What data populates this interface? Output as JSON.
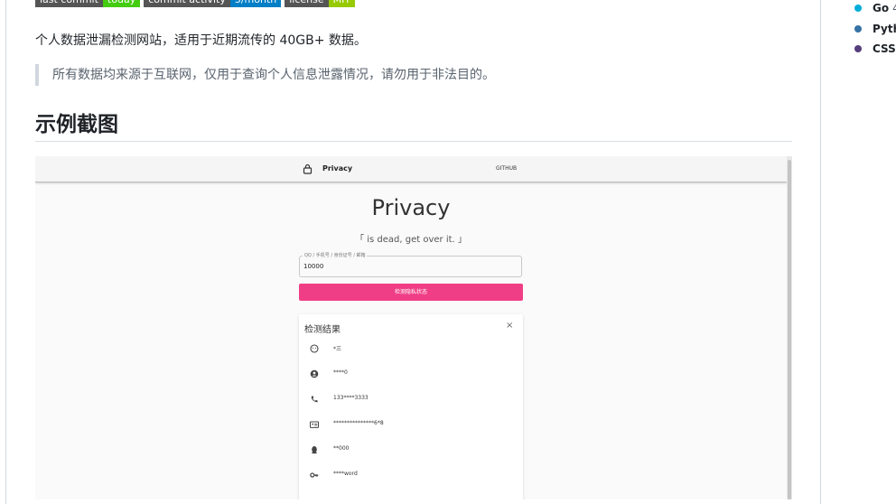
{
  "badges": [
    {
      "label": "last commit",
      "value": "today",
      "color": "#4c1"
    },
    {
      "label": "commit activity",
      "value": "5/month",
      "color": "#007ec6"
    },
    {
      "label": "license",
      "value": "MIT",
      "color": "#97ca00"
    }
  ],
  "readme": {
    "description": "个人数据泄漏检测网站，适用于近期流传的 40GB+ 数据。",
    "quote": "所有数据均来源于互联网，仅用于查询个人信息泄露情况，请勿用于非法目的。",
    "heading": "示例截图"
  },
  "screenshot": {
    "brand": "Privacy",
    "github": "GITHUB",
    "title": "Privacy",
    "subtitle": "「 is dead, get over it. 」",
    "field_label": "QQ / 手机号 / 身份证号 / 邮箱",
    "field_value": "10000",
    "button": "检测隐私状态",
    "card_title": "检测结果",
    "card_close": "×",
    "results": [
      {
        "icon": "face-icon",
        "value": "*三"
      },
      {
        "icon": "account-icon",
        "value": "****0"
      },
      {
        "icon": "phone-icon",
        "value": "133****3333"
      },
      {
        "icon": "id-card-icon",
        "value": "***************6*8"
      },
      {
        "icon": "qq-icon",
        "value": "**000"
      },
      {
        "icon": "key-icon",
        "value": "****word"
      }
    ]
  },
  "languages": [
    {
      "name": "Go",
      "percent": "4",
      "color": "#00ADD8"
    },
    {
      "name": "Pyth",
      "percent": "",
      "color": "#3572A5"
    },
    {
      "name": "CSS",
      "percent": "",
      "color": "#563d7c"
    }
  ]
}
